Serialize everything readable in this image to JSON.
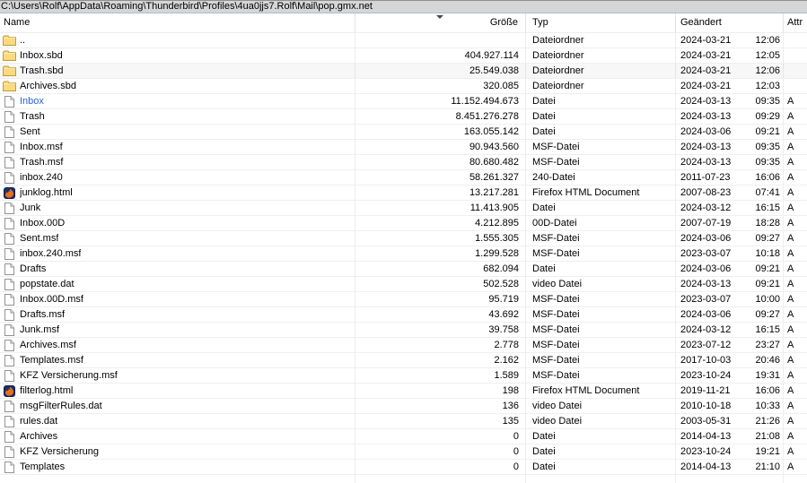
{
  "window": {
    "path": "C:\\Users\\Rolf\\AppData\\Roaming\\Thunderbird\\Profiles\\4ua0jjs7.Rolf\\Mail\\pop.gmx.net"
  },
  "table": {
    "columns": [
      {
        "id": "name",
        "label": "Name"
      },
      {
        "id": "size",
        "label": "Größe"
      },
      {
        "id": "type",
        "label": "Typ"
      },
      {
        "id": "modified",
        "label": "Geändert"
      },
      {
        "id": "attr",
        "label": "Attr"
      }
    ],
    "sort": {
      "column": "Größe",
      "direction": "descending"
    }
  },
  "colors": {
    "compressed_file_name": "#2a63d5",
    "pathbar_bg": "#d6d6d6",
    "folder_icon_fill": "#fcd97c",
    "grid_line": "#ededed"
  },
  "files": [
    {
      "name": "..",
      "icon": "folder-icon",
      "size": "",
      "type": "Dateiordner",
      "date": "2024-03-21",
      "time": "12:06",
      "attr": ""
    },
    {
      "name": "Inbox.sbd",
      "icon": "folder-icon",
      "size": "404.927.114",
      "type": "Dateiordner",
      "date": "2024-03-21",
      "time": "12:05",
      "attr": ""
    },
    {
      "name": "Trash.sbd",
      "icon": "folder-icon",
      "size": "25.549.038",
      "type": "Dateiordner",
      "date": "2024-03-21",
      "time": "12:06",
      "attr": "",
      "shaded": true
    },
    {
      "name": "Archives.sbd",
      "icon": "folder-icon",
      "size": "320.085",
      "type": "Dateiordner",
      "date": "2024-03-21",
      "time": "12:03",
      "attr": ""
    },
    {
      "name": "Inbox",
      "icon": "file-icon",
      "size": "11.152.494.673",
      "type": "Datei",
      "date": "2024-03-13",
      "time": "09:35",
      "attr": "A",
      "compressed": true
    },
    {
      "name": "Trash",
      "icon": "file-icon",
      "size": "8.451.276.278",
      "type": "Datei",
      "date": "2024-03-13",
      "time": "09:29",
      "attr": "A"
    },
    {
      "name": "Sent",
      "icon": "file-icon",
      "size": "163.055.142",
      "type": "Datei",
      "date": "2024-03-06",
      "time": "09:21",
      "attr": "A"
    },
    {
      "name": "Inbox.msf",
      "icon": "file-icon",
      "size": "90.943.560",
      "type": "MSF-Datei",
      "date": "2024-03-13",
      "time": "09:35",
      "attr": "A"
    },
    {
      "name": "Trash.msf",
      "icon": "file-icon",
      "size": "80.680.482",
      "type": "MSF-Datei",
      "date": "2024-03-13",
      "time": "09:35",
      "attr": "A"
    },
    {
      "name": "inbox.240",
      "icon": "file-icon",
      "size": "58.261.327",
      "type": "240-Datei",
      "date": "2011-07-23",
      "time": "16:06",
      "attr": "A"
    },
    {
      "name": "junklog.html",
      "icon": "firefox-icon",
      "size": "13.217.281",
      "type": "Firefox HTML Document",
      "date": "2007-08-23",
      "time": "07:41",
      "attr": "A"
    },
    {
      "name": "Junk",
      "icon": "file-icon",
      "size": "11.413.905",
      "type": "Datei",
      "date": "2024-03-12",
      "time": "16:15",
      "attr": "A"
    },
    {
      "name": "Inbox.00D",
      "icon": "file-icon",
      "size": "4.212.895",
      "type": "00D-Datei",
      "date": "2007-07-19",
      "time": "18:28",
      "attr": "A"
    },
    {
      "name": "Sent.msf",
      "icon": "file-icon",
      "size": "1.555.305",
      "type": "MSF-Datei",
      "date": "2024-03-06",
      "time": "09:27",
      "attr": "A"
    },
    {
      "name": "inbox.240.msf",
      "icon": "file-icon",
      "size": "1.299.528",
      "type": "MSF-Datei",
      "date": "2023-03-07",
      "time": "10:18",
      "attr": "A"
    },
    {
      "name": "Drafts",
      "icon": "file-icon",
      "size": "682.094",
      "type": "Datei",
      "date": "2024-03-06",
      "time": "09:21",
      "attr": "A"
    },
    {
      "name": "popstate.dat",
      "icon": "file-icon",
      "size": "502.528",
      "type": "video Datei",
      "date": "2024-03-13",
      "time": "09:21",
      "attr": "A"
    },
    {
      "name": "Inbox.00D.msf",
      "icon": "file-icon",
      "size": "95.719",
      "type": "MSF-Datei",
      "date": "2023-03-07",
      "time": "10:00",
      "attr": "A"
    },
    {
      "name": "Drafts.msf",
      "icon": "file-icon",
      "size": "43.692",
      "type": "MSF-Datei",
      "date": "2024-03-06",
      "time": "09:27",
      "attr": "A"
    },
    {
      "name": "Junk.msf",
      "icon": "file-icon",
      "size": "39.758",
      "type": "MSF-Datei",
      "date": "2024-03-12",
      "time": "16:15",
      "attr": "A"
    },
    {
      "name": "Archives.msf",
      "icon": "file-icon",
      "size": "2.778",
      "type": "MSF-Datei",
      "date": "2023-07-12",
      "time": "23:27",
      "attr": "A"
    },
    {
      "name": "Templates.msf",
      "icon": "file-icon",
      "size": "2.162",
      "type": "MSF-Datei",
      "date": "2017-10-03",
      "time": "20:46",
      "attr": "A"
    },
    {
      "name": "KFZ Versicherung.msf",
      "icon": "file-icon",
      "size": "1.589",
      "type": "MSF-Datei",
      "date": "2023-10-24",
      "time": "19:31",
      "attr": "A"
    },
    {
      "name": "filterlog.html",
      "icon": "firefox-icon",
      "size": "198",
      "type": "Firefox HTML Document",
      "date": "2019-11-21",
      "time": "16:06",
      "attr": "A"
    },
    {
      "name": "msgFilterRules.dat",
      "icon": "file-icon",
      "size": "136",
      "type": "video Datei",
      "date": "2010-10-18",
      "time": "10:33",
      "attr": "A"
    },
    {
      "name": "rules.dat",
      "icon": "file-icon",
      "size": "135",
      "type": "video Datei",
      "date": "2003-05-31",
      "time": "21:26",
      "attr": "A"
    },
    {
      "name": "Archives",
      "icon": "file-icon",
      "size": "0",
      "type": "Datei",
      "date": "2014-04-13",
      "time": "21:08",
      "attr": "A"
    },
    {
      "name": "KFZ Versicherung",
      "icon": "file-icon",
      "size": "0",
      "type": "Datei",
      "date": "2023-10-24",
      "time": "19:21",
      "attr": "A"
    },
    {
      "name": "Templates",
      "icon": "file-icon",
      "size": "0",
      "type": "Datei",
      "date": "2014-04-13",
      "time": "21:10",
      "attr": "A"
    }
  ]
}
